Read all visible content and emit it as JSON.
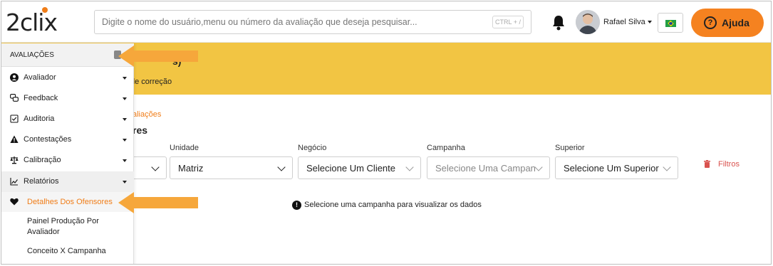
{
  "header": {
    "logo_text": "2clix",
    "search_placeholder": "Digite o nome do usuário,menu ou número da avaliação que deseja pesquisar...",
    "shortcut": "CTRL + /",
    "user_name": "Rafael Silva",
    "help_label": "Ajuda",
    "help_icon_glyph": "?"
  },
  "banner": {
    "title": "s)",
    "subtitle": "de correção"
  },
  "content": {
    "breadcrumb": "aliações",
    "title": "res",
    "filters": [
      {
        "label": "Unidade",
        "value": "Matriz",
        "placeholder": false
      },
      {
        "label": "Negócio",
        "value": "Selecione Um Cliente",
        "placeholder": false
      },
      {
        "label": "Campanha",
        "value": "Selecione Uma Campanha",
        "placeholder": true
      },
      {
        "label": "Superior",
        "value": "Selecione Um Superior",
        "placeholder": false
      }
    ],
    "filter_button": "Filtros",
    "notice": "Selecione uma campanha para visualizar os dados",
    "notice_glyph": "!"
  },
  "sidebar": {
    "section_title": "AVALIAÇÕES",
    "items": [
      {
        "label": "Avaliador",
        "icon": "user-circle-icon"
      },
      {
        "label": "Feedback",
        "icon": "chat-icon"
      },
      {
        "label": "Auditoria",
        "icon": "checkbox-icon"
      },
      {
        "label": "Contestações",
        "icon": "warning-icon"
      },
      {
        "label": "Calibração",
        "icon": "scale-icon"
      },
      {
        "label": "Relatórios",
        "icon": "chart-line-icon"
      }
    ],
    "subitems": [
      {
        "label": "Detalhes Dos Ofensores",
        "active": true
      },
      {
        "label": "Painel Produção Por Avaliador",
        "active": false
      },
      {
        "label": "Conceito X Campanha",
        "active": false
      }
    ]
  },
  "colors": {
    "accent_orange": "#f58220",
    "banner_yellow": "#f2c543",
    "link_orange": "#f07d18",
    "danger_red": "#d9534f",
    "arrow_orange": "#f6a73b"
  }
}
